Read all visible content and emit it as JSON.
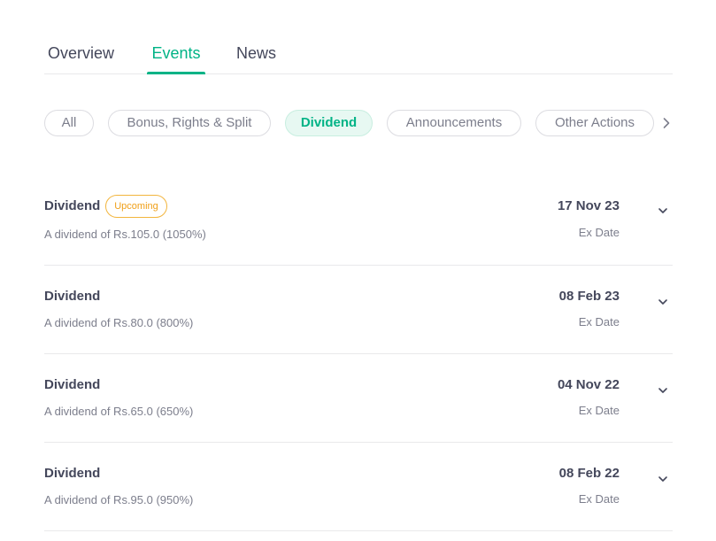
{
  "tabs": [
    {
      "label": "Overview"
    },
    {
      "label": "Events"
    },
    {
      "label": "News"
    }
  ],
  "active_tab": "Events",
  "filters": [
    {
      "label": "All"
    },
    {
      "label": "Bonus, Rights & Split"
    },
    {
      "label": "Dividend"
    },
    {
      "label": "Announcements"
    },
    {
      "label": "Other Actions"
    }
  ],
  "active_filter": "Dividend",
  "events": [
    {
      "title": "Dividend",
      "badge": "Upcoming",
      "description": "A dividend of Rs.105.0 (1050%)",
      "date": "17 Nov 23",
      "date_label": "Ex Date"
    },
    {
      "title": "Dividend",
      "description": "A dividend of Rs.80.0 (800%)",
      "date": "08 Feb 23",
      "date_label": "Ex Date"
    },
    {
      "title": "Dividend",
      "description": "A dividend of Rs.65.0 (650%)",
      "date": "04 Nov 22",
      "date_label": "Ex Date"
    },
    {
      "title": "Dividend",
      "description": "A dividend of Rs.95.0 (950%)",
      "date": "08 Feb 22",
      "date_label": "Ex Date"
    }
  ],
  "colors": {
    "accent": "#00b386",
    "badge": "#f0a019",
    "text_primary": "#44475b",
    "text_secondary": "#7c7e8c"
  },
  "icons": {
    "filters_next": "chevron-right-icon",
    "expand": "chevron-down-icon"
  }
}
